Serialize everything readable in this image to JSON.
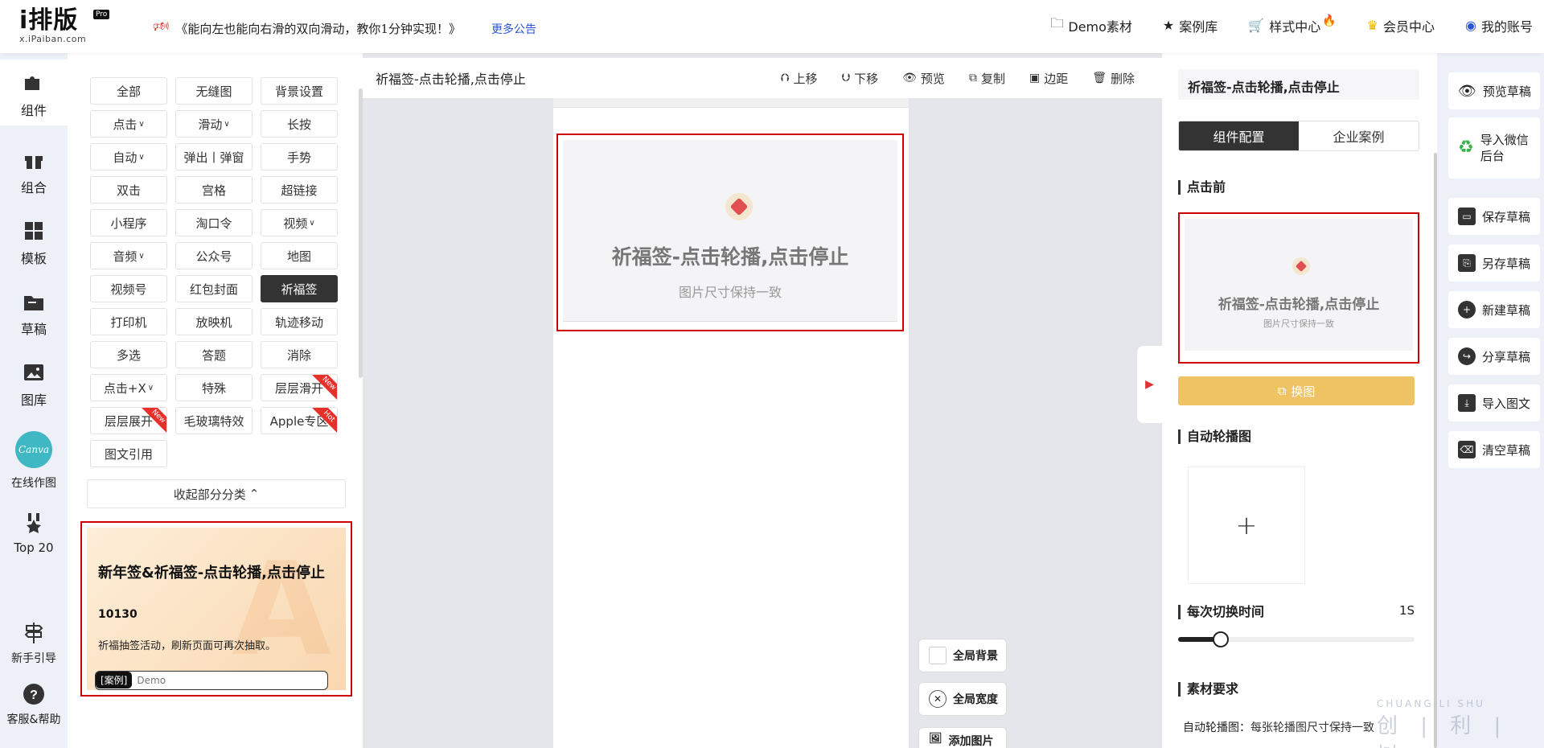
{
  "header": {
    "logo": "i排版",
    "logo_badge": "Pro",
    "logo_domain": "x.iPaiban.com",
    "announcement": "《能向左也能向右滑的双向滑动，教你1分钟实现！》",
    "more_link": "更多公告",
    "nav": [
      "Demo素材",
      "案例库",
      "样式中心",
      "会员中心",
      "我的账号"
    ]
  },
  "leftbar": {
    "items": [
      "组件",
      "组合",
      "模板",
      "草稿",
      "图库",
      "在线作图",
      "Top 20",
      "新手引导",
      "客服&帮助"
    ],
    "canva_logo": "Canva"
  },
  "panel": {
    "buttons": [
      "全部",
      "无缝图",
      "背景设置",
      "点击",
      "滑动",
      "长按",
      "自动",
      "弹出丨弹窗",
      "手势",
      "双击",
      "宫格",
      "超链接",
      "小程序",
      "淘口令",
      "视频",
      "音频",
      "公众号",
      "地图",
      "视频号",
      "红包封面",
      "祈福签",
      "打印机",
      "放映机",
      "轨迹移动",
      "多选",
      "答题",
      "消除",
      "点击+X",
      "特殊",
      "层层滑开",
      "层层展开",
      "毛玻璃特效",
      "Apple专区",
      "图文引用"
    ],
    "dropdown_suffix": "∨",
    "badge_new": "New",
    "badge_hot": "Hot",
    "collapse_label": "收起部分分类",
    "promo": {
      "title": "新年签&祈福签-点击轮播,点击停止",
      "number": "10130",
      "desc": "祈福抽签活动，刷新页面可再次抽取。",
      "tag_label": "[案例]",
      "tag_text": "Demo",
      "bg_letter": "A"
    }
  },
  "toolbar": {
    "title": "祈福签-点击轮播,点击停止",
    "tools": [
      "上移",
      "下移",
      "预览",
      "复制",
      "边距",
      "删除"
    ]
  },
  "canvas": {
    "component_title": "祈福签-点击轮播,点击停止",
    "component_sub": "图片尺寸保持一致",
    "float_buttons": [
      "全局背景",
      "全局宽度",
      "添加图片"
    ]
  },
  "config": {
    "title": "祈福签-点击轮播,点击停止",
    "tabs": [
      "组件配置",
      "企业案例"
    ],
    "section_before": "点击前",
    "preview_title": "祈福签-点击轮播,点击停止",
    "preview_sub": "图片尺寸保持一致",
    "swap_label": "换图",
    "section_carousel": "自动轮播图",
    "upload_plus": "+",
    "section_interval": "每次切换时间",
    "interval_value": "1S",
    "interval_fraction": 0.18,
    "section_requirement": "素材要求",
    "requirement_label": "自动轮播图：",
    "requirement_text": "每张轮播图尺寸保持一致"
  },
  "rightbar": {
    "items": [
      "预览草稿",
      "导入微信后台",
      "保存草稿",
      "另存草稿",
      "新建草稿",
      "分享草稿",
      "导入图文",
      "清空草稿"
    ]
  },
  "watermark": {
    "line1": "CHUANG LI SHU",
    "line2": "创 | 利 | 树"
  },
  "colors": {
    "highlight_red": "#c00000",
    "swap_button": "#efc264",
    "dark": "#333333",
    "sidebar_bg": "#eef0f7"
  }
}
